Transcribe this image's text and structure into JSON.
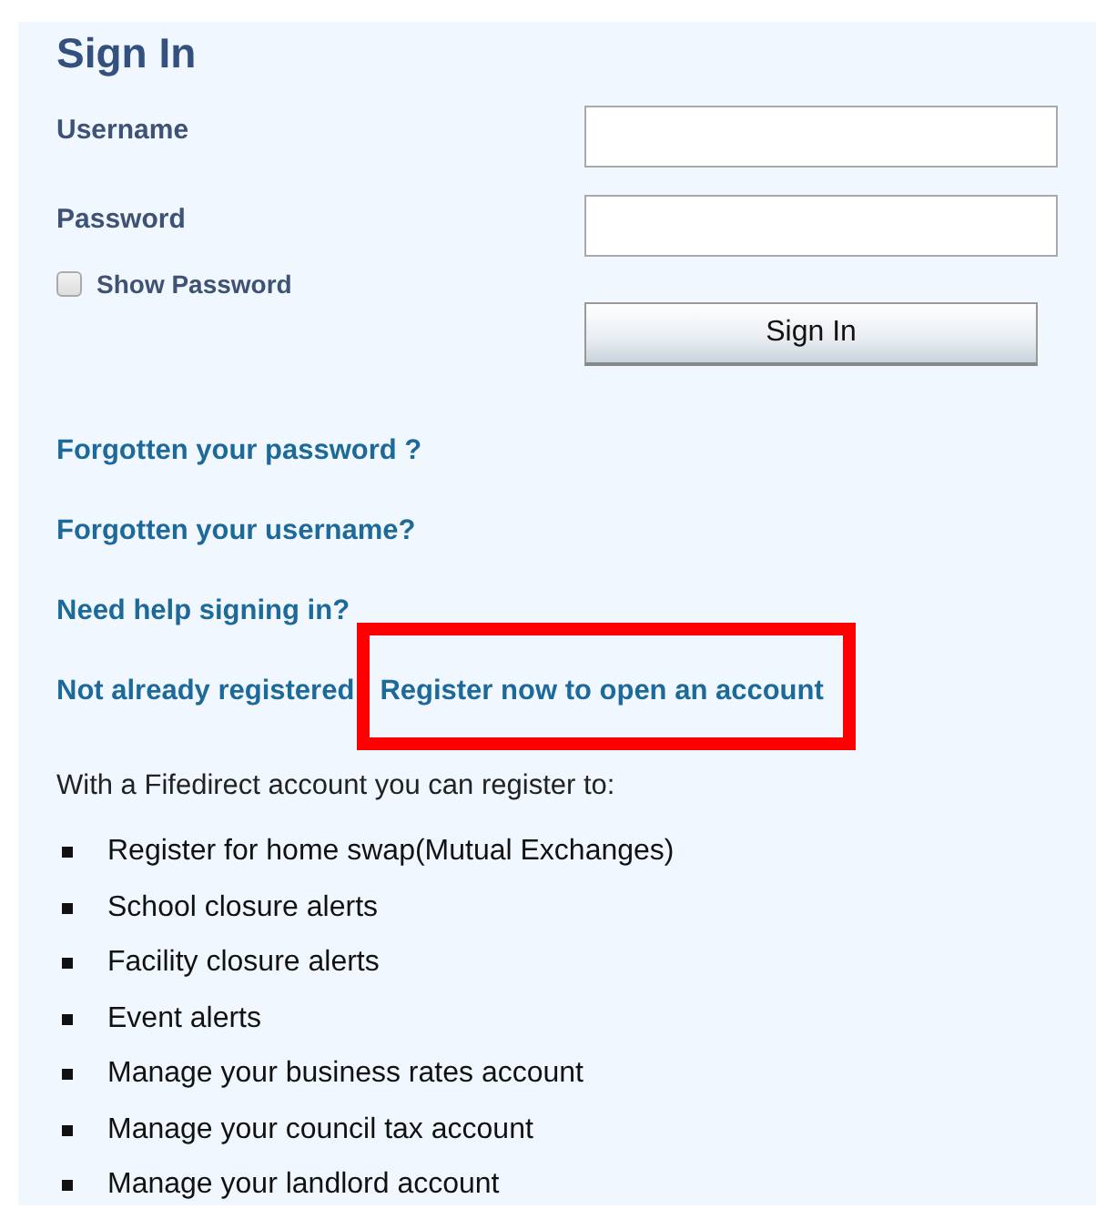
{
  "title": "Sign In",
  "fields": [
    {
      "label": "Username"
    },
    {
      "label": "Password"
    }
  ],
  "show_password": {
    "label": "Show Password",
    "checked": false
  },
  "submit": "Sign In",
  "links": [
    {
      "text": "Forgotten your password ?"
    },
    {
      "text": "Forgotten your username?"
    },
    {
      "text": "Need help signing in?"
    }
  ],
  "register": {
    "prompt": "Not already registered",
    "link": "Register now to open an account",
    "highlighted": true
  },
  "intro": "With a Fifedirect account you can register to:",
  "benefits": [
    "Register for home swap(Mutual Exchanges)",
    "School closure alerts",
    "Facility closure alerts",
    "Event alerts",
    "Manage your business rates account",
    "Manage your council tax account",
    "Manage your landlord account"
  ]
}
